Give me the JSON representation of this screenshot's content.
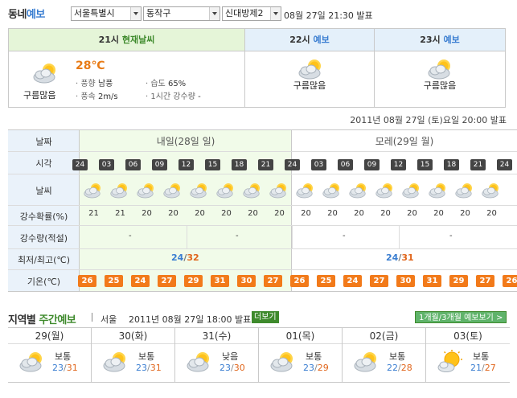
{
  "header": {
    "title_a": "동네",
    "title_b": "예보",
    "sel_city": "서울특별시",
    "sel_gu": "동작구",
    "sel_dong": "신대방제2",
    "time": "08월 27일 21:30 발표"
  },
  "now": {
    "col1_head_a": "21시",
    "col1_head_b": "현재날씨",
    "temp": "28℃",
    "desc": "구름많음",
    "wind_dir_label": "· 풍향",
    "wind_dir": "남풍",
    "wind_spd_label": "· 풍속",
    "wind_spd": "2m/s",
    "hum_label": "· 습도",
    "hum": "65%",
    "rain_label": "· 1시간 강수량",
    "rain": "-",
    "col2_head_a": "22시",
    "col2_head_b": "예보",
    "col2_desc": "구름많음",
    "col3_head_a": "23시",
    "col3_head_b": "예보",
    "col3_desc": "구름많음"
  },
  "issued": "2011년 08월 27일 (토)요일 20:00 발표",
  "hourly": {
    "labels": [
      "날짜",
      "시각",
      "날씨",
      "강수확률(%)",
      "강수량(적설)",
      "최저/최고(℃)",
      "기온(℃)"
    ],
    "day1": "내일(28일 일)",
    "day2": "모레(29일 월)",
    "hours": [
      "24",
      "03",
      "06",
      "09",
      "12",
      "15",
      "18",
      "21",
      "24",
      "03",
      "06",
      "09",
      "12",
      "15",
      "18",
      "21",
      "24"
    ],
    "rain_prob": [
      "21",
      "21",
      "20",
      "20",
      "20",
      "20",
      "20",
      "20",
      "20",
      "20",
      "20",
      "20",
      "20",
      "20",
      "20",
      "20",
      "21"
    ],
    "rain_amt": [
      "-",
      "-",
      "-",
      "-"
    ],
    "min1": "24",
    "max1": "32",
    "min2": "24",
    "max2": "31",
    "slash": "/",
    "temps": [
      "26",
      "25",
      "24",
      "27",
      "29",
      "31",
      "30",
      "27",
      "26",
      "25",
      "24",
      "27",
      "30",
      "31",
      "29",
      "27",
      "26"
    ]
  },
  "weekly": {
    "title_a": "지역별",
    "title_b": "주간예보",
    "city": "서울",
    "time": "2011년 08월 27일 18:00 발표",
    "more": "더보기",
    "monthly": "1개월/3개월 예보보기 >",
    "days": [
      {
        "date": "29(월)",
        "desc": "보통",
        "min": "23",
        "max": "31"
      },
      {
        "date": "30(화)",
        "desc": "보통",
        "min": "23",
        "max": "31"
      },
      {
        "date": "31(수)",
        "desc": "낮음",
        "min": "23",
        "max": "30"
      },
      {
        "date": "01(목)",
        "desc": "보통",
        "min": "23",
        "max": "29"
      },
      {
        "date": "02(금)",
        "desc": "보통",
        "min": "22",
        "max": "28"
      },
      {
        "date": "03(토)",
        "desc": "보통",
        "min": "21",
        "max": "27"
      }
    ]
  },
  "colors": {
    "accent_blue": "#3a7ed1",
    "accent_green": "#3e8a2c",
    "temp_orange": "#f27a1a"
  },
  "icons": {
    "cloudy": "partly-cloudy-icon",
    "sunny": "sun-cloud-icon"
  }
}
